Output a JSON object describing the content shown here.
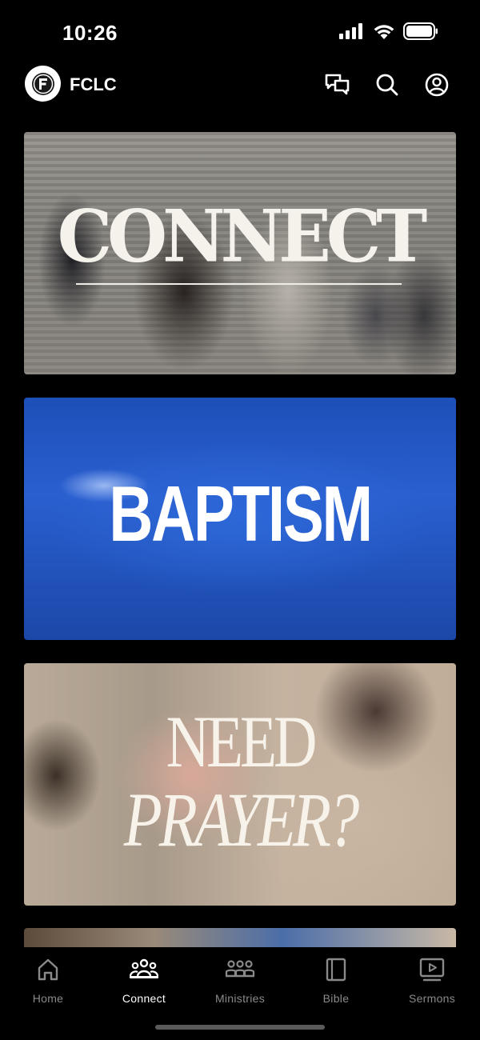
{
  "status_bar": {
    "time": "10:26",
    "icons": [
      "cellular-signal-icon",
      "wifi-icon",
      "battery-icon"
    ]
  },
  "header": {
    "app_name": "FCLC",
    "logo_letter": "F",
    "actions": [
      "chat-icon",
      "search-icon",
      "account-icon"
    ]
  },
  "cards": {
    "connect": {
      "title": "CONNECT"
    },
    "baptism": {
      "title": "BAPTISM"
    },
    "prayer": {
      "title_line1": "NEED",
      "title_line2": "PRAYER?"
    }
  },
  "tab_bar": {
    "active": "Connect",
    "tabs": [
      {
        "label": "Home",
        "icon": "home-icon"
      },
      {
        "label": "Connect",
        "icon": "people-icon"
      },
      {
        "label": "Ministries",
        "icon": "group-icon"
      },
      {
        "label": "Bible",
        "icon": "book-icon"
      },
      {
        "label": "Sermons",
        "icon": "video-icon"
      }
    ]
  },
  "colors": {
    "background": "#000000",
    "active_tab": "#ffffff",
    "inactive_tab": "#8a8a8a"
  }
}
